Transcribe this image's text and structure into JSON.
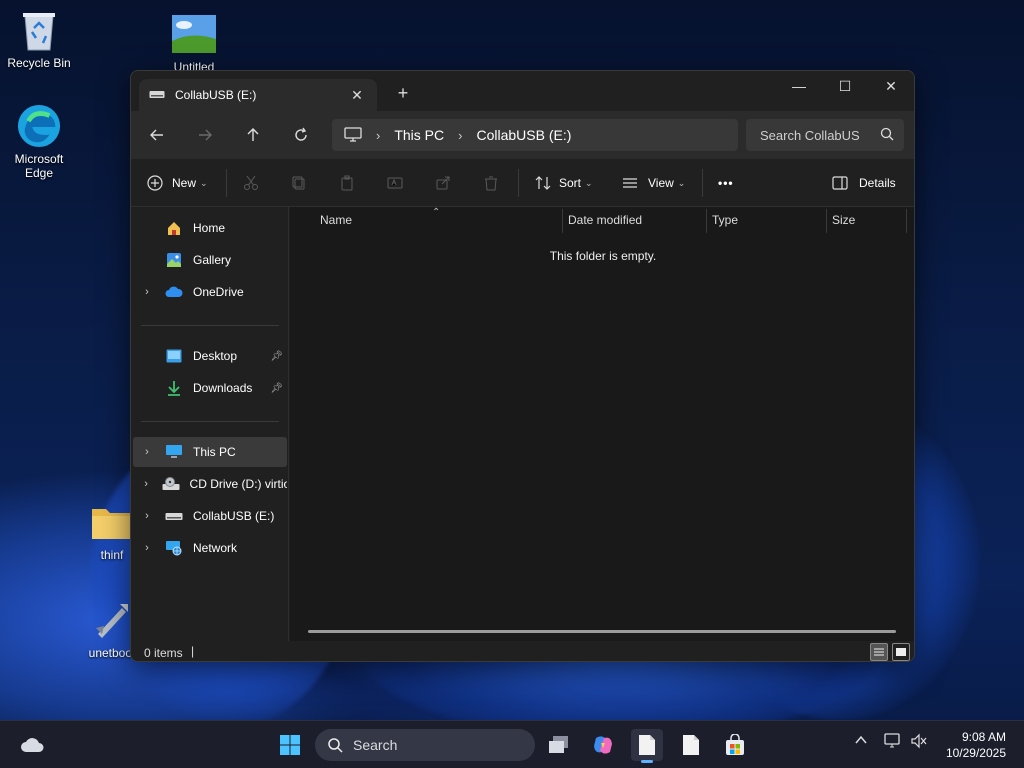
{
  "desktop": {
    "icons": [
      {
        "label": "Recycle Bin"
      },
      {
        "label": "Untitled"
      },
      {
        "label": "Microsoft Edge"
      },
      {
        "label": "thinf"
      },
      {
        "label": "unetboot"
      }
    ]
  },
  "window": {
    "tab_title": "CollabUSB (E:)",
    "address": {
      "crumbs": [
        "This PC",
        "CollabUSB (E:)"
      ]
    },
    "search_placeholder": "Search CollabUS",
    "toolbar": {
      "new_label": "New",
      "sort_label": "Sort",
      "view_label": "View",
      "more_label": "•••",
      "details_label": "Details"
    },
    "sidebar": {
      "quick": [
        {
          "label": "Home"
        },
        {
          "label": "Gallery"
        },
        {
          "label": "OneDrive"
        }
      ],
      "pinned": [
        {
          "label": "Desktop"
        },
        {
          "label": "Downloads"
        }
      ],
      "devices": [
        {
          "label": "This PC"
        },
        {
          "label": "CD Drive (D:) virtio-"
        },
        {
          "label": "CollabUSB (E:)"
        },
        {
          "label": "Network"
        }
      ]
    },
    "columns": [
      "Name",
      "Date modified",
      "Type",
      "Size"
    ],
    "empty_message": "This folder is empty.",
    "status": {
      "count": "0 items"
    }
  },
  "taskbar": {
    "search_label": "Search",
    "time": "9:08 AM",
    "date": "10/29/2025"
  },
  "colors": {
    "accent": "#5fb2ff",
    "window_bg": "#202020",
    "content_bg": "#191919"
  }
}
